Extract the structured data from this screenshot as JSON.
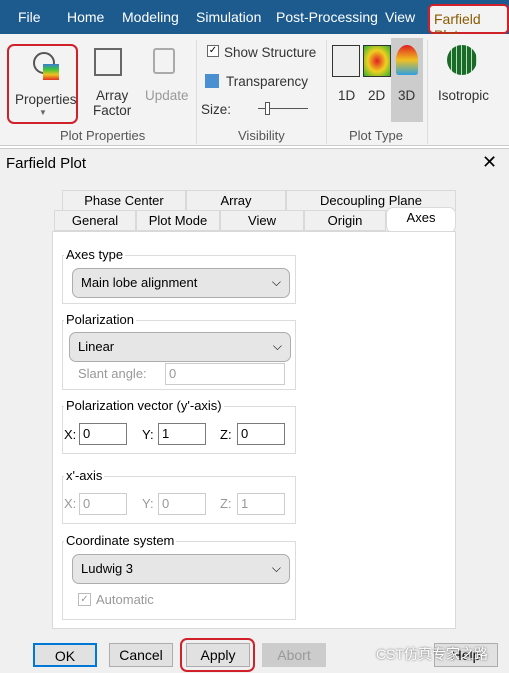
{
  "ribbon": {
    "tabs": [
      "File",
      "Home",
      "Modeling",
      "Simulation",
      "Post-Processing",
      "View",
      "Farfield Plot"
    ],
    "properties": "Properties",
    "array_factor_1": "Array",
    "array_factor_2": "Factor",
    "update": "Update",
    "show_structure": "Show Structure",
    "transparency": "Transparency",
    "size": "Size:",
    "d1": "1D",
    "d2": "2D",
    "d3": "3D",
    "isotropic": "Isotropic",
    "groups": [
      "Plot Properties",
      "Visibility",
      "Plot Type"
    ]
  },
  "dialog": {
    "title": "Farfield Plot",
    "tabs_back": [
      "Phase Center",
      "Array",
      "Decoupling Plane"
    ],
    "tabs_front": [
      "General",
      "Plot Mode",
      "View",
      "Origin",
      "Axes"
    ],
    "axes_type": {
      "label": "Axes type",
      "value": "Main lobe alignment"
    },
    "polarization": {
      "label": "Polarization",
      "value": "Linear",
      "slant_label": "Slant angle:",
      "slant_value": "0"
    },
    "pol_vector": {
      "label": "Polarization vector (y'-axis)",
      "x": "0",
      "y": "1",
      "z": "0"
    },
    "x_axis": {
      "label": "x'-axis",
      "x": "0",
      "y": "0",
      "z": "1"
    },
    "coord": {
      "label": "Coordinate system",
      "value": "Ludwig 3",
      "automatic": "Automatic"
    },
    "axis_labels": {
      "x": "X:",
      "y": "Y:",
      "z": "Z:"
    },
    "buttons": {
      "ok": "OK",
      "cancel": "Cancel",
      "apply": "Apply",
      "abort": "Abort",
      "help": "Help"
    },
    "watermark": "CST仿真专家之路"
  },
  "colors": {
    "menubar": "#1d5b8f",
    "highlight": "#d0212a"
  }
}
